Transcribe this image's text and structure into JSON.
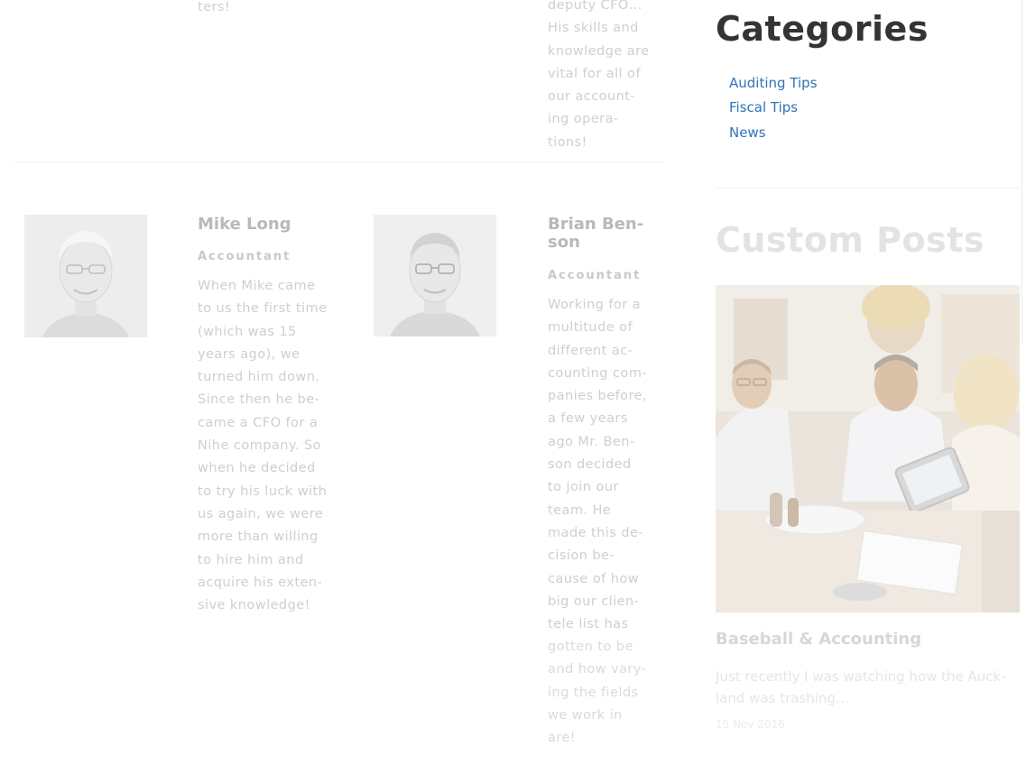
{
  "team": {
    "top_left_fragment": "ters!",
    "top_right_fragment": "deputy CFO…\nHis skills and\nknowledge are\nvital for all of\nour account-\ning opera-\ntions!",
    "members": [
      {
        "name": "Mike Long",
        "role": "Accountant",
        "bio": "When Mike came\nto us the first time\n(which was 15\nyears ago), we\nturned him down.\nSince then he be-\ncame a CFO for a\nNihe company. So\nwhen he decided\nto try his luck with\nus again, we were\nmore than willing\nto hire him and\nacquire his exten-\nsive knowledge!"
      },
      {
        "name": "Brian Ben-\nson",
        "role": "Accountant",
        "bio": "Working for a\nmultitude of\ndifferent ac-\ncounting com-\npanies before,\na few years\nago Mr. Ben-\nson decided\nto join our\nteam. He\nmade this de-\ncision be-\ncause of how\nbig our clien-\ntele list has",
        "bio_faded": "gotten to be\nand how vary-\ning the fields\nwe work in\nare!"
      }
    ]
  },
  "sidebar": {
    "categories": {
      "title": "Categories",
      "items": [
        "Auditing Tips",
        "Fiscal Tips",
        "News"
      ]
    },
    "custom_posts": {
      "title": "Custom Posts",
      "post": {
        "title": "Baseball & Accounting",
        "excerpt": "Just recently I was watching how the Auck-\nland was trashing…",
        "date": "15 Nov 2016"
      }
    }
  },
  "colors": {
    "link": "#2f73b6",
    "heading": "#343434"
  }
}
